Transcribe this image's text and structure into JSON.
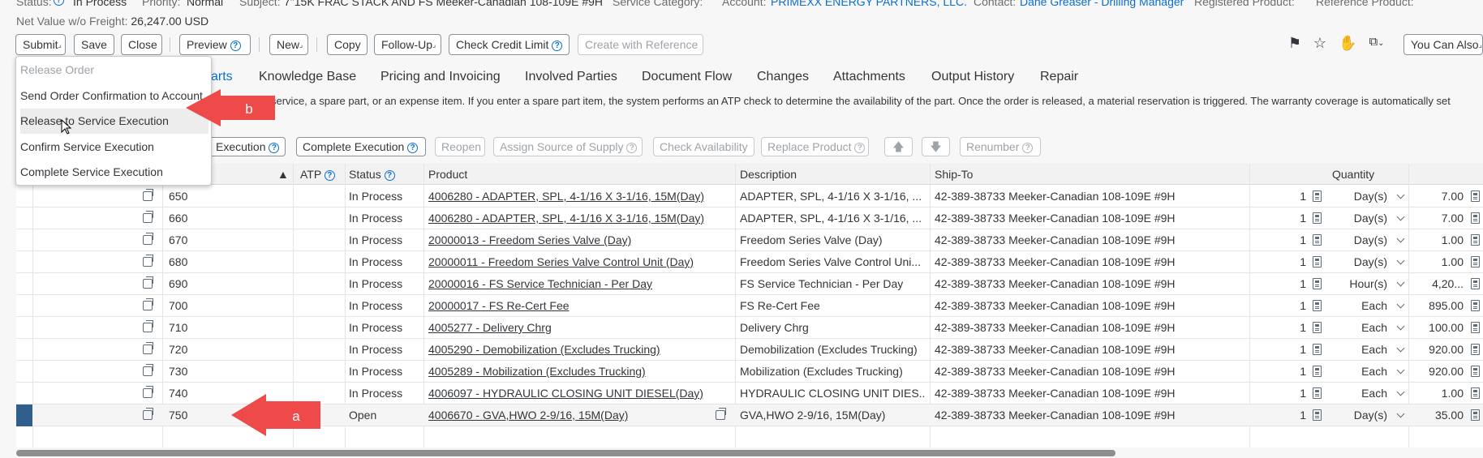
{
  "header": {
    "status_label": "Status:",
    "status_value": "In Process",
    "priority_label": "Priority:",
    "priority_value": "Normal",
    "subject_label": "Subject:",
    "subject_value": "7\"15K FRAC STACK AND FS  Meeker-Canadian 108-109E #9H",
    "service_category_label": "Service Category:",
    "account_label": "Account:",
    "account_value": "PRIMEXX ENERGY PARTNERS, LLC.",
    "contact_label": "Contact:",
    "contact_value": "Dane Greaser - Drilling Manager",
    "registered_product_label": "Registered Product:",
    "reference_product_label": "Reference Product:",
    "net_value_label": "Net Value w/o Freight:",
    "net_value": "26,247.00 USD"
  },
  "toolbar": {
    "submit": "Submit",
    "save": "Save",
    "close": "Close",
    "preview": "Preview",
    "new": "New",
    "copy": "Copy",
    "follow_up": "Follow-Up",
    "check_credit_limit": "Check Credit Limit",
    "create_with_reference": "Create with Reference",
    "you_can_also": "You Can Also"
  },
  "submit_menu": {
    "items": [
      {
        "label": "Release Order",
        "enabled": false
      },
      {
        "label": "Send Order Confirmation to Account",
        "enabled": true
      },
      {
        "label": "Release to Service Execution",
        "enabled": true
      },
      {
        "label": "Confirm Service Execution",
        "enabled": true
      },
      {
        "label": "Complete Service Execution",
        "enabled": true
      }
    ]
  },
  "tabs": {
    "partial": "arts",
    "knowledge_base": "Knowledge Base",
    "pricing": "Pricing and Invoicing",
    "involved_parties": "Involved Parties",
    "document_flow": "Document Flow",
    "changes": "Changes",
    "attachments": "Attachments",
    "output_history": "Output History",
    "repair": "Repair"
  },
  "description_text": "service, a spare part, or an expense item. If you enter a spare part item, the system performs an ATP check to determine the availability of the part. Once the order is released, a material reservation is triggered. The warranty coverage is automatically set",
  "row_toolbar": {
    "execution": "Execution",
    "complete_execution": "Complete Execution",
    "reopen": "Reopen",
    "assign_source": "Assign Source of Supply",
    "check_availability": "Check Availability",
    "replace_product": "Replace Product",
    "renumber": "Renumber"
  },
  "table": {
    "headers": {
      "atp": "ATP",
      "status": "Status",
      "product": "Product",
      "description": "Description",
      "ship_to": "Ship-To",
      "quantity": "Quantity"
    },
    "rows": [
      {
        "item": "650",
        "status": "In Process",
        "product": "4006280 - ADAPTER, SPL, 4-1/16 X 3-1/16, 15M(Day)",
        "description": "ADAPTER, SPL, 4-1/16 X 3-1/16, ...",
        "ship_to": "42-389-38733 Meeker-Canadian 108-109E #9H",
        "qty": "1",
        "unit": "Day(s)",
        "price": "7.00"
      },
      {
        "item": "660",
        "status": "In Process",
        "product": "4006280 - ADAPTER, SPL, 4-1/16 X 3-1/16, 15M(Day)",
        "description": "ADAPTER, SPL, 4-1/16 X 3-1/16, ...",
        "ship_to": "42-389-38733 Meeker-Canadian 108-109E #9H",
        "qty": "1",
        "unit": "Day(s)",
        "price": "7.00"
      },
      {
        "item": "670",
        "status": "In Process",
        "product": "20000013 - Freedom Series Valve (Day)",
        "description": "Freedom Series Valve (Day)",
        "ship_to": "42-389-38733 Meeker-Canadian 108-109E #9H",
        "qty": "1",
        "unit": "Day(s)",
        "price": "1.00"
      },
      {
        "item": "680",
        "status": "In Process",
        "product": "20000011 - Freedom Series Valve Control Unit (Day)",
        "description": "Freedom Series Valve Control Uni...",
        "ship_to": "42-389-38733 Meeker-Canadian 108-109E #9H",
        "qty": "1",
        "unit": "Day(s)",
        "price": "1.00"
      },
      {
        "item": "690",
        "status": "In Process",
        "product": "20000016 - FS Service Technician - Per Day",
        "description": "FS Service Technician - Per Day",
        "ship_to": "42-389-38733 Meeker-Canadian 108-109E #9H",
        "qty": "1",
        "unit": "Hour(s)",
        "price": "4,20..."
      },
      {
        "item": "700",
        "status": "In Process",
        "product": "20000017 - FS Re-Cert Fee",
        "description": "FS Re-Cert Fee",
        "ship_to": "42-389-38733 Meeker-Canadian 108-109E #9H",
        "qty": "1",
        "unit": "Each",
        "price": "895.00"
      },
      {
        "item": "710",
        "status": "In Process",
        "product": "4005277 - Delivery Chrg",
        "description": "Delivery Chrg",
        "ship_to": "42-389-38733 Meeker-Canadian 108-109E #9H",
        "qty": "1",
        "unit": "Each",
        "price": "100.00"
      },
      {
        "item": "720",
        "status": "In Process",
        "product": "4005290 - Demobilization (Excludes Trucking)",
        "description": "Demobilization (Excludes Trucking)",
        "ship_to": "42-389-38733 Meeker-Canadian 108-109E #9H",
        "qty": "1",
        "unit": "Each",
        "price": "920.00"
      },
      {
        "item": "730",
        "status": "In Process",
        "product": "4005289 - Mobilization (Excludes Trucking)",
        "description": "Mobilization (Excludes Trucking)",
        "ship_to": "42-389-38733 Meeker-Canadian 108-109E #9H",
        "qty": "1",
        "unit": "Each",
        "price": "920.00"
      },
      {
        "item": "740",
        "status": "In Process",
        "product": "4006097 - HYDRAULIC CLOSING UNIT DIESEL(Day)",
        "description": "HYDRAULIC CLOSING UNIT DIES...",
        "ship_to": "42-389-38733 Meeker-Canadian 108-109E #9H",
        "qty": "1",
        "unit": "Each",
        "price": "1.00"
      },
      {
        "item": "750",
        "status": "Open",
        "product": "4006670 - GVA,HWO 2-9/16, 15M(Day)",
        "description": "GVA,HWO 2-9/16, 15M(Day)",
        "ship_to": "42-389-38733 Meeker-Canadian 108-109E #9H",
        "qty": "1",
        "unit": "Day(s)",
        "price": "35.00"
      }
    ]
  },
  "annotations": {
    "arrow_a": "a",
    "arrow_b": "b",
    "arrow_color": "#ef4a4a"
  }
}
